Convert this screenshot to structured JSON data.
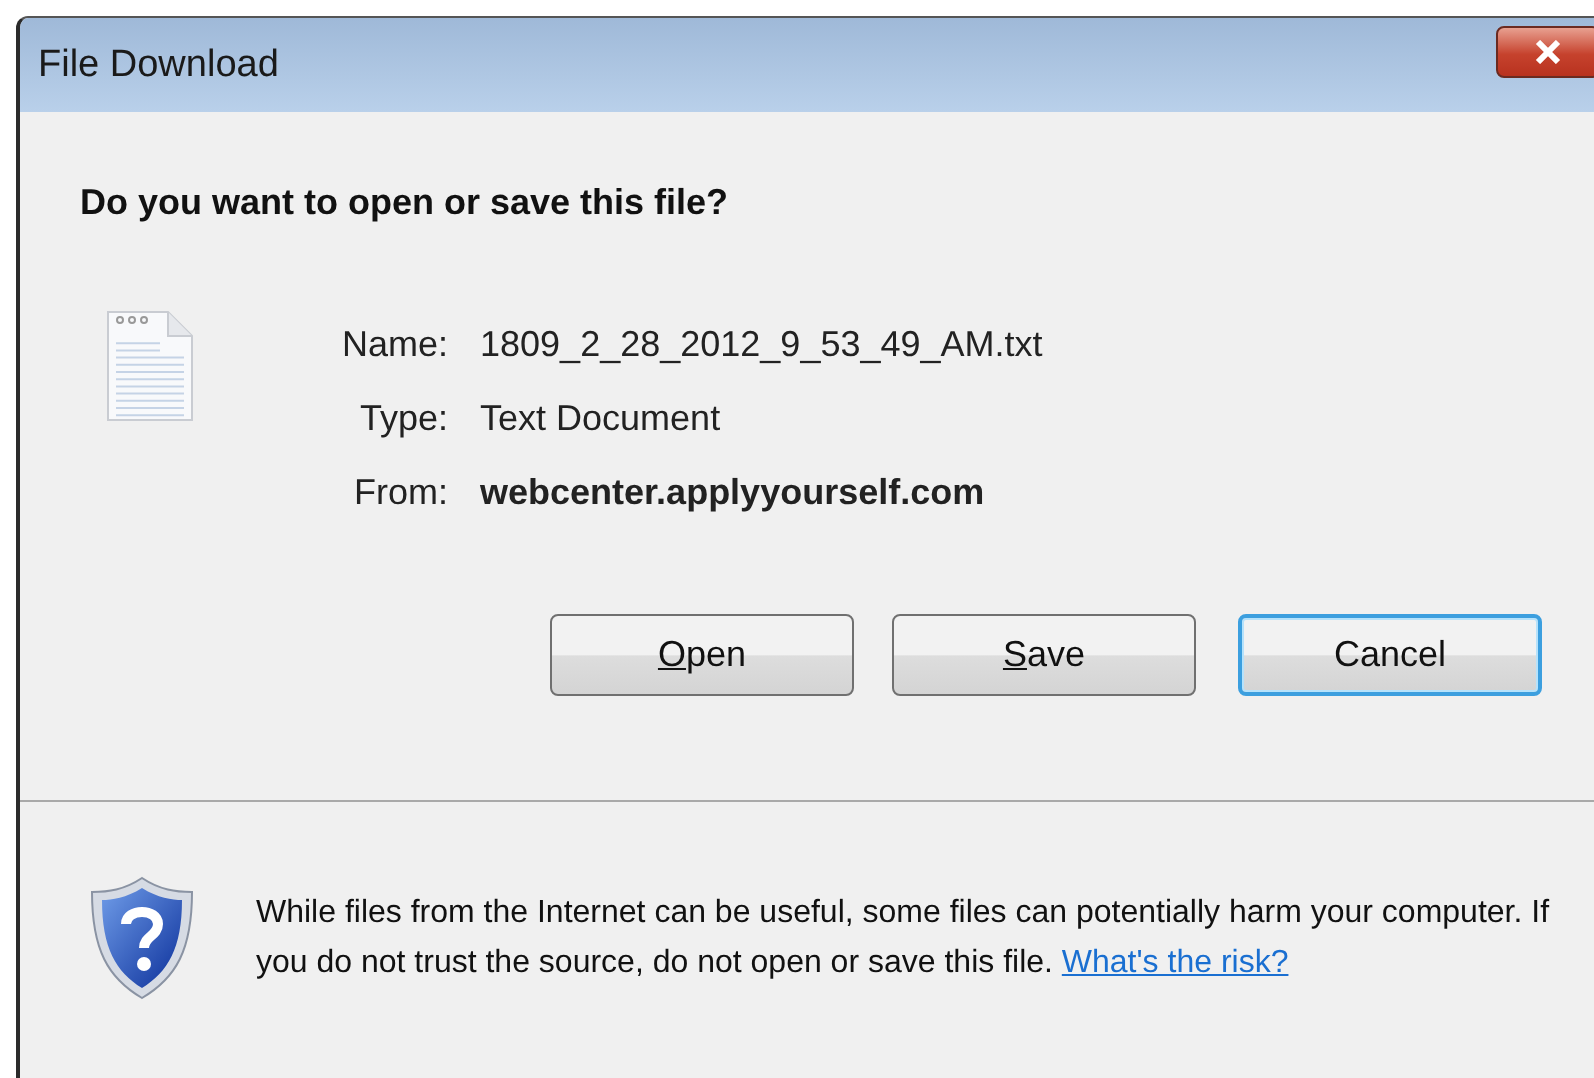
{
  "window": {
    "title": "File Download"
  },
  "question": "Do you want to open or save this file?",
  "fields": [
    {
      "label": "Name:",
      "value": "1809_2_28_2012_9_53_49_AM.txt",
      "bold": false
    },
    {
      "label": "Type:",
      "value": "Text Document",
      "bold": false
    },
    {
      "label": "From:",
      "value": "webcenter.applyyourself.com",
      "bold": true
    }
  ],
  "buttons": [
    {
      "accel": "O",
      "rest": "pen",
      "focused": false
    },
    {
      "accel": "S",
      "rest": "ave",
      "focused": false
    },
    {
      "rest": "Cancel",
      "focused": true
    }
  ],
  "warning": {
    "text": "While files from the Internet can be useful, some files can potentially harm your computer. If you do not trust the source, do not open or save this file.",
    "link": "What's the risk?"
  }
}
